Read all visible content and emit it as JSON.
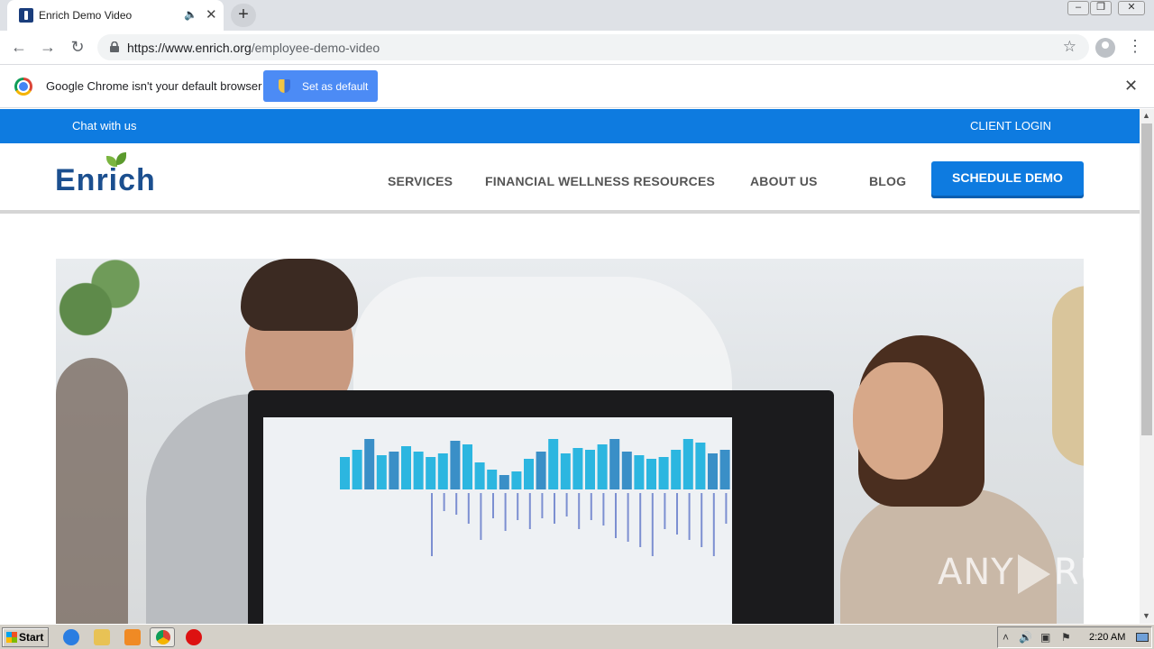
{
  "browser": {
    "tab_title": "Enrich Demo Video",
    "url_host": "https://www.enrich.org",
    "url_path": "/employee-demo-video",
    "infobar_text": "Google Chrome isn't your default browser",
    "set_default_label": "Set as default"
  },
  "site": {
    "topbar": {
      "chat": "Chat with us",
      "client_login": "CLIENT LOGIN"
    },
    "logo": "Enrich",
    "nav": [
      {
        "label": "SERVICES"
      },
      {
        "label": "FINANCIAL WELLNESS RESOURCES"
      },
      {
        "label": "ABOUT US"
      },
      {
        "label": "BLOG"
      }
    ],
    "cta": "SCHEDULE DEMO"
  },
  "watermark": {
    "left": "ANY",
    "right": "RUN"
  },
  "taskbar": {
    "start_label": "Start",
    "clock": "2:20 AM"
  },
  "colors": {
    "brand_blue": "#0e7be0",
    "logo_blue": "#1b4f8f",
    "leaf_green": "#7bb540"
  }
}
